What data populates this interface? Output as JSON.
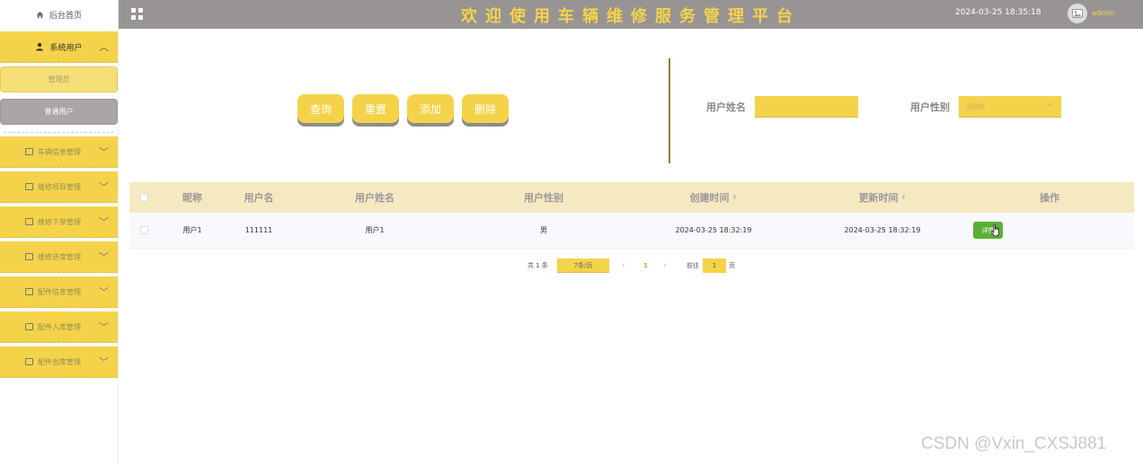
{
  "sidebar": {
    "home_label": "后台首页",
    "group": {
      "label": "系统用户",
      "items": [
        "管理员",
        "普通用户"
      ]
    },
    "menus": [
      "车辆信息管理",
      "维修项目管理",
      "维修下单管理",
      "维修进度管理",
      "配件信息管理",
      "配件入库管理",
      "配件出库管理"
    ]
  },
  "header": {
    "title": "欢迎使用车辆维修服务管理平台",
    "datetime": "2024-03-25 18:35:18",
    "username": "admin"
  },
  "toolbar": {
    "query_label": "查询",
    "reset_label": "重置",
    "add_label": "添加",
    "delete_label": "删除"
  },
  "search": {
    "name_label": "用户姓名",
    "name_value": "",
    "gender_label": "用户性别",
    "gender_placeholder": "请选择"
  },
  "table": {
    "columns": [
      "昵称",
      "用户名",
      "用户姓名",
      "用户性别",
      "创建时间",
      "更新时间",
      "操作"
    ],
    "rows": [
      {
        "nickname": "用户1",
        "username": "111111",
        "realname": "用户1",
        "gender": "男",
        "created": "2024-03-25 18:32:19",
        "updated": "2024-03-25 18:32:19",
        "action": "详情"
      }
    ]
  },
  "pagination": {
    "total": "共 1 条",
    "page_size": "7条/页",
    "prev": "‹",
    "current": "1",
    "next": "›",
    "goto_label": "前往",
    "goto_value": "1",
    "page_suffix": "页"
  },
  "watermark": "CSDN @Vxin_CXSJ881",
  "colors": {
    "accent": "#f4d34a",
    "topbar": "#989494",
    "table_header": "#f5e9c2",
    "detail_button": "#5ab035",
    "divider": "#9a7a3a"
  }
}
